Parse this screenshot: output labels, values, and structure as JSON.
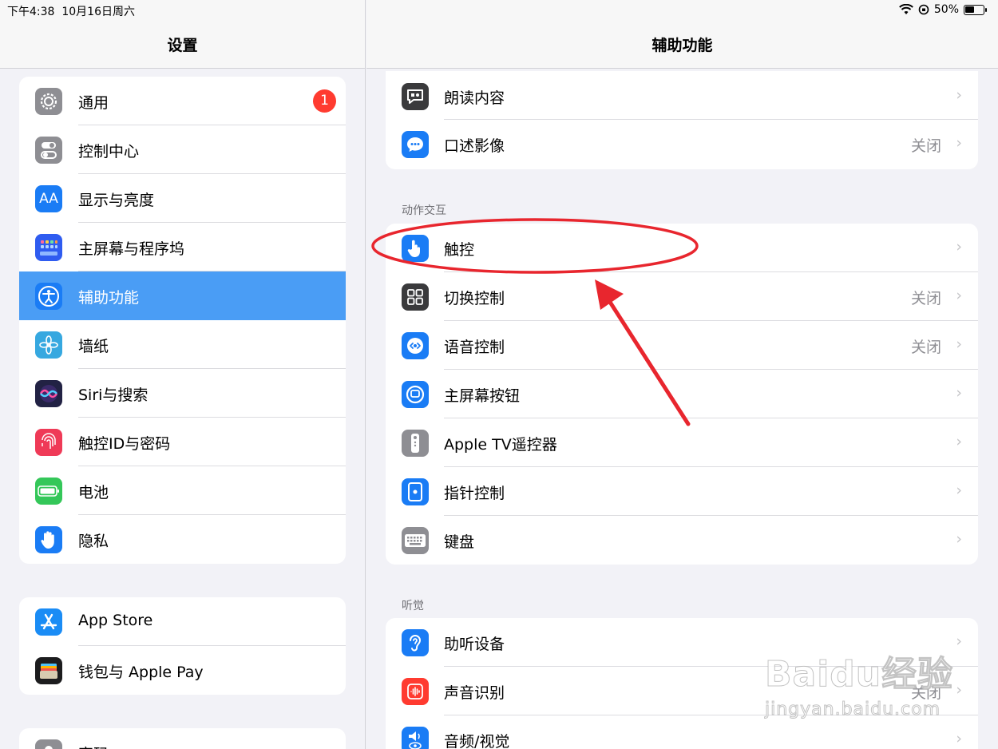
{
  "status_bar": {
    "time": "下午4:38",
    "date": "10月16日周六",
    "battery": "50%"
  },
  "left": {
    "title": "设置",
    "group1": [
      {
        "label": "通用",
        "icon": "gear-icon",
        "color": "#8e8e93",
        "badge": "1"
      },
      {
        "label": "控制中心",
        "icon": "toggle-icon",
        "color": "#8e8e93"
      },
      {
        "label": "显示与亮度",
        "icon": "text-size-icon",
        "color": "#1a7cf5"
      },
      {
        "label": "主屏幕与程序坞",
        "icon": "home-grid-icon",
        "color": "#2f5cf0"
      },
      {
        "label": "辅助功能",
        "icon": "accessibility-icon",
        "color": "#1a7cf5",
        "selected": true
      },
      {
        "label": "墙纸",
        "icon": "flower-icon",
        "color": "#36a8e0"
      },
      {
        "label": "Siri与搜索",
        "icon": "siri-icon",
        "color": "#222244"
      },
      {
        "label": "触控ID与密码",
        "icon": "fingerprint-icon",
        "color": "#ef3a57"
      },
      {
        "label": "电池",
        "icon": "battery-icon",
        "color": "#34c759"
      },
      {
        "label": "隐私",
        "icon": "hand-icon",
        "color": "#1a7cf5"
      }
    ],
    "group2": [
      {
        "label": "App Store",
        "icon": "app-store-icon",
        "color": "#1a8cf5"
      },
      {
        "label": "钱包与 Apple Pay",
        "icon": "wallet-icon",
        "color": "#1c1c1e"
      }
    ],
    "group3": [
      {
        "label": "密码",
        "icon": "key-icon",
        "color": "#8e8e93"
      }
    ]
  },
  "right": {
    "title": "辅助功能",
    "group_top": [
      {
        "label": "朗读内容",
        "icon": "speech-bubble-icon",
        "color": "#3a3a3c",
        "value": ""
      },
      {
        "label": "口述影像",
        "icon": "audio-description-icon",
        "color": "#1a7cf5",
        "value": "关闭"
      }
    ],
    "section_interaction": "动作交互",
    "group_interaction": [
      {
        "label": "触控",
        "icon": "touch-hand-icon",
        "color": "#1a7cf5",
        "value": ""
      },
      {
        "label": "切换控制",
        "icon": "switch-grid-icon",
        "color": "#3a3a3c",
        "value": "关闭"
      },
      {
        "label": "语音控制",
        "icon": "voice-control-icon",
        "color": "#1a7cf5",
        "value": "关闭"
      },
      {
        "label": "主屏幕按钮",
        "icon": "home-button-icon",
        "color": "#1a7cf5",
        "value": ""
      },
      {
        "label": "Apple TV遥控器",
        "icon": "remote-icon",
        "color": "#8e8e93",
        "value": ""
      },
      {
        "label": "指针控制",
        "icon": "pointer-icon",
        "color": "#1a7cf5",
        "value": ""
      },
      {
        "label": "键盘",
        "icon": "keyboard-icon",
        "color": "#8e8e93",
        "value": ""
      }
    ],
    "section_hearing": "听觉",
    "group_hearing": [
      {
        "label": "助听设备",
        "icon": "ear-icon",
        "color": "#1a7cf5",
        "value": ""
      },
      {
        "label": "声音识别",
        "icon": "sound-recognition-icon",
        "color": "#ff3b30",
        "value": "关闭"
      },
      {
        "label": "音频/视觉",
        "icon": "audio-visual-icon",
        "color": "#1a7cf5",
        "value": ""
      }
    ]
  },
  "watermark": {
    "logo": "Baidu经验",
    "url": "jingyan.baidu.com"
  }
}
